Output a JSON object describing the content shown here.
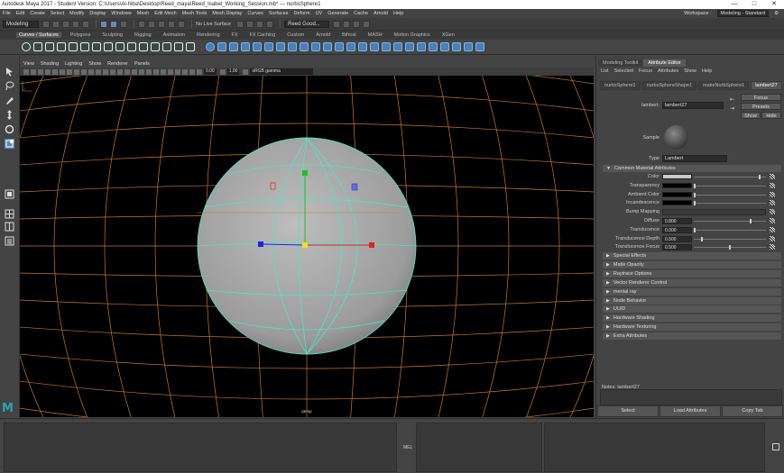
{
  "window": {
    "title": "Autodesk Maya 2017 - Student Version: C:\\Users\\Al-hiba\\Desktop\\Reed_maya\\Reed_Isabel_Working_Session.mb*  ---  nurbsSphere1",
    "controls": [
      "—",
      "□",
      "✕"
    ]
  },
  "menubar": {
    "items": [
      "File",
      "Edit",
      "Create",
      "Select",
      "Modify",
      "Display",
      "Windows",
      "Mesh",
      "Edit Mesh",
      "Mesh Tools",
      "Mesh Display",
      "Curves",
      "Surfaces",
      "Deform",
      "UV",
      "Generate",
      "Cache",
      "Arnold",
      "Help"
    ],
    "workspace_label": "Workspace :",
    "workspace_value": "Modeling - Standard"
  },
  "statusline": {
    "mode": "Modeling",
    "live_surface": "No Live Surface",
    "user": "Reed Good..."
  },
  "shelf": {
    "tabs": [
      "Curves / Surfaces",
      "Polygons",
      "Sculpting",
      "Rigging",
      "Animation",
      "Rendering",
      "FX",
      "FX Caching",
      "Custom",
      "Arnold",
      "Bifrost",
      "MASH",
      "Motion Graphics",
      "XGen"
    ],
    "active_tab": 0
  },
  "viewport": {
    "menu": [
      "View",
      "Shading",
      "Lighting",
      "Show",
      "Renderer",
      "Panels"
    ],
    "field_a": "0.00",
    "field_b": "1.00",
    "color_space": "sRGB gamma",
    "camera_label": "persp"
  },
  "right_panel": {
    "tabs": [
      "Modeling Toolkit",
      "Attribute Editor"
    ],
    "active_tab": 1,
    "menu": [
      "List",
      "Selected",
      "Focus",
      "Attributes",
      "Show",
      "Help"
    ],
    "node_tabs": [
      "nurbsSphere1",
      "nurbsSphereShape1",
      "makeNurbSphere1",
      "lambert27"
    ],
    "active_node_tab": 3,
    "node_type_label": "lambert:",
    "node_name": "lambert27",
    "focus_label": "Focus",
    "presets_label": "Presets",
    "show_label": "Show",
    "hide_label": "Hide",
    "sample_label": "Sample",
    "type_label": "Type",
    "type_value": "Lambert",
    "common_section": "Common Material Attributes",
    "attributes": [
      {
        "label": "Color",
        "kind": "swatch",
        "swatch": "#c8c8c8",
        "slider": 0.92
      },
      {
        "label": "Transparency",
        "kind": "swatch",
        "swatch": "#000000",
        "slider": 0.0
      },
      {
        "label": "Ambient Color",
        "kind": "swatch",
        "swatch": "#000000",
        "slider": 0.0
      },
      {
        "label": "Incandescence",
        "kind": "swatch",
        "swatch": "#000000",
        "slider": 0.0
      },
      {
        "label": "Bump Mapping",
        "kind": "wide"
      },
      {
        "label": "Diffuse",
        "kind": "value",
        "value": "0.800",
        "slider": 0.8
      },
      {
        "label": "Translucence",
        "kind": "value",
        "value": "0.000",
        "slider": 0.0
      },
      {
        "label": "Translucence Depth",
        "kind": "value",
        "value": "0.500",
        "slider": 0.1
      },
      {
        "label": "Translucence Focus",
        "kind": "value",
        "value": "0.500",
        "slider": 0.5
      }
    ],
    "sections": [
      "Special Effects",
      "Matte Opacity",
      "Raytrace Options",
      "Vector Renderer Control",
      "mental ray",
      "Node Behavior",
      "UUID",
      "Hardware Shading",
      "Hardware Texturing",
      "Extra Attributes"
    ],
    "notes_label": "Notes: lambert27",
    "bottom_buttons": [
      "Select",
      "Load Attributes",
      "Copy Tab"
    ]
  },
  "bottom": {
    "mel_label": "MEL"
  },
  "logo": "M",
  "colors": {
    "grid": "#c8782a",
    "wire": "#4de6c2",
    "x_axis": "#e62020",
    "y_axis": "#20c020",
    "z_axis": "#2020e6",
    "accent": "#2ba3b4"
  }
}
